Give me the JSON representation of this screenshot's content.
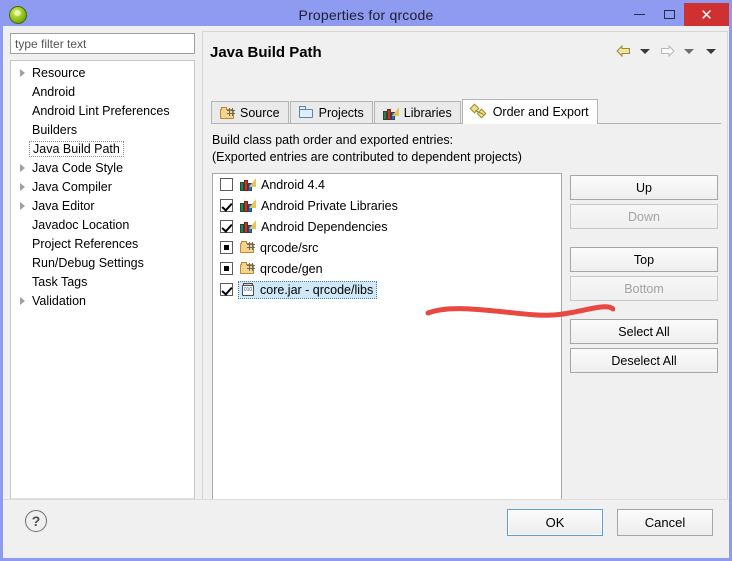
{
  "window": {
    "title": "Properties for qrcode",
    "icon": "eclipse-app-icon",
    "controls": {
      "minimize": "–",
      "maximize": "□",
      "close": "✕"
    }
  },
  "sidebar": {
    "filter": {
      "placeholder": "type filter text",
      "value": ""
    },
    "items": [
      {
        "label": "Resource",
        "expandable": true,
        "selected": false
      },
      {
        "label": "Android",
        "expandable": false,
        "selected": false
      },
      {
        "label": "Android Lint Preferences",
        "expandable": false,
        "selected": false
      },
      {
        "label": "Builders",
        "expandable": false,
        "selected": false
      },
      {
        "label": "Java Build Path",
        "expandable": false,
        "selected": true
      },
      {
        "label": "Java Code Style",
        "expandable": true,
        "selected": false
      },
      {
        "label": "Java Compiler",
        "expandable": true,
        "selected": false
      },
      {
        "label": "Java Editor",
        "expandable": true,
        "selected": false
      },
      {
        "label": "Javadoc Location",
        "expandable": false,
        "selected": false
      },
      {
        "label": "Project References",
        "expandable": false,
        "selected": false
      },
      {
        "label": "Run/Debug Settings",
        "expandable": false,
        "selected": false
      },
      {
        "label": "Task Tags",
        "expandable": false,
        "selected": false
      },
      {
        "label": "Validation",
        "expandable": true,
        "selected": false
      }
    ],
    "scrollbar": {
      "left_arrow": "❮",
      "right_arrow": "❯"
    }
  },
  "main": {
    "page_title": "Java Build Path",
    "nav": {
      "back_icon": "back-arrow-icon",
      "back_menu_icon": "chevron-down-icon",
      "forward_icon": "forward-arrow-icon",
      "forward_menu_icon": "chevron-down-icon",
      "more_icon": "chevron-down-icon"
    },
    "tabs": [
      {
        "label": "Source",
        "icon": "source-folder-icon",
        "active": false
      },
      {
        "label": "Projects",
        "icon": "projects-icon",
        "active": false
      },
      {
        "label": "Libraries",
        "icon": "libraries-books-icon",
        "active": false
      },
      {
        "label": "Order and Export",
        "icon": "order-export-icon",
        "active": true
      }
    ],
    "description_line1": "Build class path order and exported entries:",
    "description_line2": "(Exported entries are contributed to dependent projects)",
    "entries": [
      {
        "label": "Android 4.4",
        "checkbox": "unchecked",
        "icon": "libraries-books-icon",
        "selected": false
      },
      {
        "label": "Android Private Libraries",
        "checkbox": "checked",
        "icon": "libraries-books-icon",
        "selected": false
      },
      {
        "label": "Android Dependencies",
        "checkbox": "checked",
        "icon": "libraries-books-icon",
        "selected": false
      },
      {
        "label": "qrcode/src",
        "checkbox": "partial",
        "icon": "source-folder-icon",
        "selected": false
      },
      {
        "label": "qrcode/gen",
        "checkbox": "partial",
        "icon": "source-folder-icon",
        "selected": false
      },
      {
        "label": "core.jar - qrcode/libs",
        "checkbox": "checked",
        "icon": "jar-file-icon",
        "selected": true
      }
    ],
    "side_buttons": [
      {
        "label": "Up",
        "enabled": true
      },
      {
        "label": "Down",
        "enabled": false
      },
      {
        "label": "Top",
        "enabled": true
      },
      {
        "label": "Bottom",
        "enabled": false
      },
      {
        "label": "Select All",
        "enabled": true
      },
      {
        "label": "Deselect All",
        "enabled": true
      }
    ]
  },
  "footer": {
    "help_icon": "?",
    "ok_label": "OK",
    "cancel_label": "Cancel"
  },
  "annotation": {
    "type": "hand-drawn-underline",
    "color": "#e8483f",
    "target": "core.jar - qrcode/libs"
  },
  "colors": {
    "titlebar": "#8f9bf0",
    "close_button": "#cf3030",
    "dialog_bg": "#f0f0f0",
    "selection": "#cfe8f7",
    "annotation_red": "#e8483f"
  }
}
